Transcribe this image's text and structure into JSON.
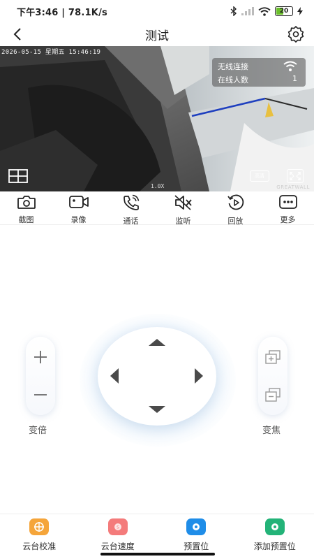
{
  "status_bar": {
    "time_speed": "下午3:46 | 78.1K/s",
    "battery": "20"
  },
  "header": {
    "title": "测试"
  },
  "video": {
    "timestamp": "2026-05-15 星期五 15:46:19",
    "info": {
      "wireless_label": "无线连接",
      "online_label": "在线人数",
      "online_count": "1"
    },
    "hd_label": "高清",
    "speed": "1.0X",
    "watermark": "GREATWALL"
  },
  "toolbar": {
    "items": [
      {
        "label": "截图",
        "icon": "camera-icon"
      },
      {
        "label": "录像",
        "icon": "video-record-icon"
      },
      {
        "label": "通话",
        "icon": "phone-icon"
      },
      {
        "label": "监听",
        "icon": "speaker-mute-icon"
      },
      {
        "label": "回放",
        "icon": "playback-icon"
      },
      {
        "label": "更多",
        "icon": "more-icon"
      }
    ]
  },
  "controls": {
    "zoom_label": "变倍",
    "focus_label": "变焦"
  },
  "bottom_bar": {
    "items": [
      {
        "label": "云台校准",
        "icon": "calibrate-icon",
        "color": "#f5a53a"
      },
      {
        "label": "云台速度",
        "icon": "speed-icon",
        "color": "#f47b7b"
      },
      {
        "label": "预置位",
        "icon": "preset-icon",
        "color": "#1f8de8"
      },
      {
        "label": "添加预置位",
        "icon": "add-preset-icon",
        "color": "#23b378"
      }
    ]
  }
}
